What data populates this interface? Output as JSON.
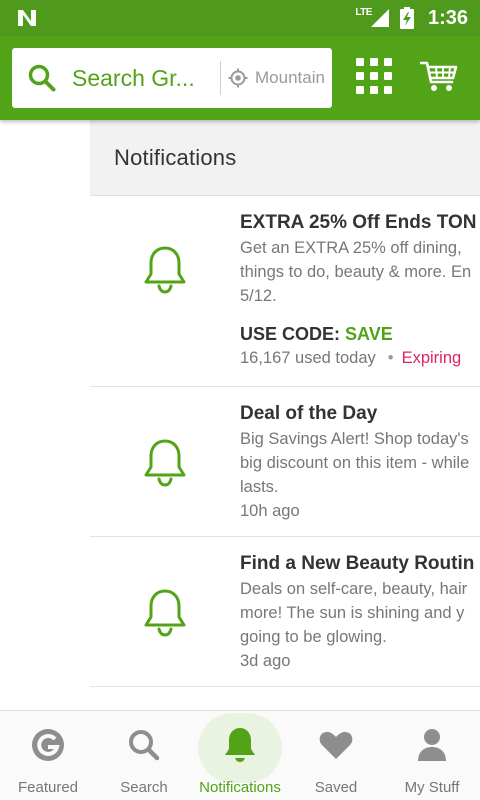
{
  "status_bar": {
    "network": "LTE",
    "time": "1:36"
  },
  "header": {
    "search_placeholder": "Search Gr...",
    "location": "Mountain"
  },
  "panel": {
    "title": "Notifications"
  },
  "notifications": [
    {
      "title": "EXTRA 25% Off Ends TON",
      "body": "Get an EXTRA 25% off dining,\nthings to do, beauty & more. En\n5/12.",
      "code_label": "USE CODE:",
      "code": "SAVE",
      "used": "16,167 used today",
      "separator": "•",
      "expiring": "Expiring"
    },
    {
      "title": "Deal of the Day",
      "body": "Big Savings Alert! Shop today's\nbig discount on this item - while\nlasts.",
      "time": "10h ago"
    },
    {
      "title": "Find a New Beauty Routin",
      "body": "Deals on self-care, beauty, hair\nmore! The sun is shining and y\ngoing to be glowing.",
      "time": "3d ago"
    }
  ],
  "bottom_nav": [
    {
      "label": "Featured",
      "icon": "groupon-g-icon"
    },
    {
      "label": "Search",
      "icon": "search-icon"
    },
    {
      "label": "Notifications",
      "icon": "bell-icon",
      "active": true
    },
    {
      "label": "Saved",
      "icon": "heart-icon"
    },
    {
      "label": "My Stuff",
      "icon": "person-icon"
    }
  ],
  "colors": {
    "brand_green": "#53a318",
    "status_green": "#4f9a1c",
    "expiring_red": "#e0245e"
  }
}
